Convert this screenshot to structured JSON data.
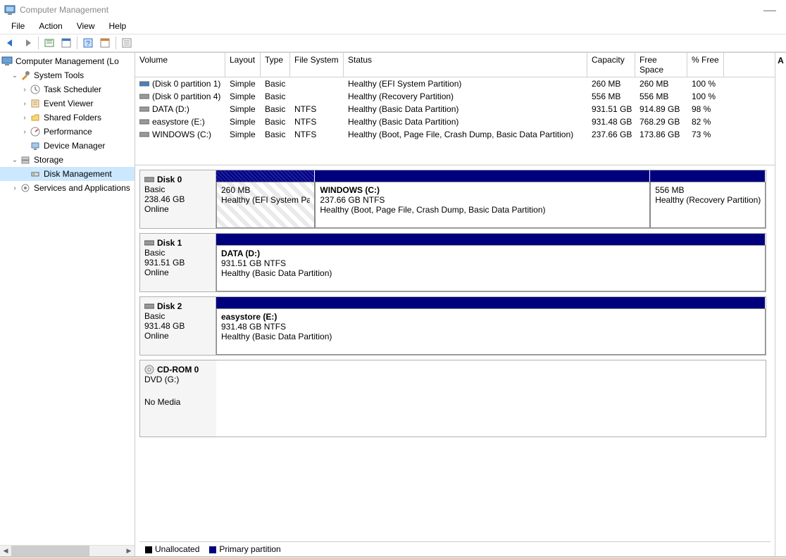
{
  "title": "Computer Management",
  "menu": {
    "file": "File",
    "action": "Action",
    "view": "View",
    "help": "Help"
  },
  "tree": {
    "root": "Computer Management (Lo",
    "system_tools": "System Tools",
    "task_scheduler": "Task Scheduler",
    "event_viewer": "Event Viewer",
    "shared_folders": "Shared Folders",
    "performance": "Performance",
    "device_manager": "Device Manager",
    "storage": "Storage",
    "disk_management": "Disk Management",
    "services_apps": "Services and Applications"
  },
  "vol_cols": {
    "volume": "Volume",
    "layout": "Layout",
    "type": "Type",
    "filesystem": "File System",
    "status": "Status",
    "capacity": "Capacity",
    "free": "Free Space",
    "pctfree": "% Free"
  },
  "volumes": [
    {
      "name": "(Disk 0 partition 1)",
      "layout": "Simple",
      "type": "Basic",
      "fs": "",
      "status": "Healthy (EFI System Partition)",
      "cap": "260 MB",
      "free": "260 MB",
      "pct": "100 %",
      "icon": "blue"
    },
    {
      "name": "(Disk 0 partition 4)",
      "layout": "Simple",
      "type": "Basic",
      "fs": "",
      "status": "Healthy (Recovery Partition)",
      "cap": "556 MB",
      "free": "556 MB",
      "pct": "100 %",
      "icon": "gray"
    },
    {
      "name": "DATA (D:)",
      "layout": "Simple",
      "type": "Basic",
      "fs": "NTFS",
      "status": "Healthy (Basic Data Partition)",
      "cap": "931.51 GB",
      "free": "914.89 GB",
      "pct": "98 %",
      "icon": "gray"
    },
    {
      "name": "easystore (E:)",
      "layout": "Simple",
      "type": "Basic",
      "fs": "NTFS",
      "status": "Healthy (Basic Data Partition)",
      "cap": "931.48 GB",
      "free": "768.29 GB",
      "pct": "82 %",
      "icon": "gray"
    },
    {
      "name": "WINDOWS (C:)",
      "layout": "Simple",
      "type": "Basic",
      "fs": "NTFS",
      "status": "Healthy (Boot, Page File, Crash Dump, Basic Data Partition)",
      "cap": "237.66 GB",
      "free": "173.86 GB",
      "pct": "73 %",
      "icon": "gray"
    }
  ],
  "disks": [
    {
      "name": "Disk 0",
      "type": "Basic",
      "size": "238.46 GB",
      "state": "Online",
      "parts": [
        {
          "title": "",
          "line1": "260 MB",
          "line2": "Healthy (EFI System Partiti",
          "widthpct": 18,
          "hatch": true
        },
        {
          "title": "WINDOWS  (C:)",
          "line1": "237.66 GB NTFS",
          "line2": "Healthy (Boot, Page File, Crash Dump, Basic Data Partition)",
          "widthpct": 61,
          "hatch": false
        },
        {
          "title": "",
          "line1": "556 MB",
          "line2": "Healthy (Recovery Partition)",
          "widthpct": 21,
          "hatch": false
        }
      ]
    },
    {
      "name": "Disk 1",
      "type": "Basic",
      "size": "931.51 GB",
      "state": "Online",
      "parts": [
        {
          "title": "DATA  (D:)",
          "line1": "931.51 GB NTFS",
          "line2": "Healthy (Basic Data Partition)",
          "widthpct": 100,
          "hatch": false
        }
      ]
    },
    {
      "name": "Disk 2",
      "type": "Basic",
      "size": "931.48 GB",
      "state": "Online",
      "parts": [
        {
          "title": "easystore  (E:)",
          "line1": "931.48 GB NTFS",
          "line2": "Healthy (Basic Data Partition)",
          "widthpct": 100,
          "hatch": false
        }
      ]
    }
  ],
  "cdrom": {
    "name": "CD-ROM 0",
    "type": "DVD (G:)",
    "state": "No Media"
  },
  "legend": {
    "unallocated": "Unallocated",
    "primary": "Primary partition"
  },
  "right_strip": "A"
}
